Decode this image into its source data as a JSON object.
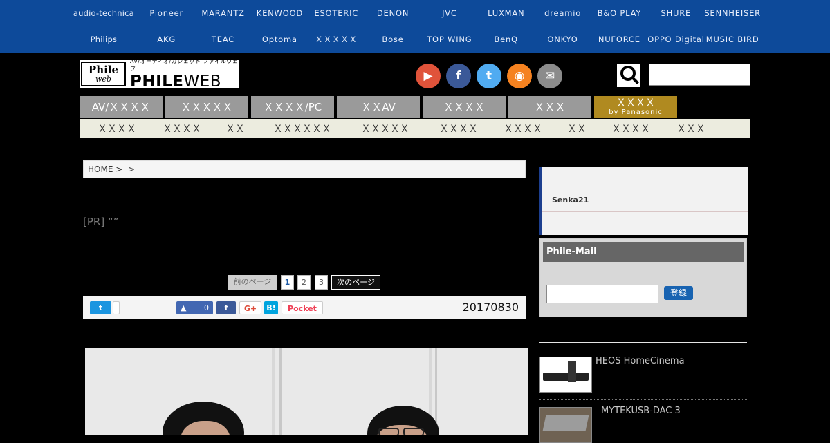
{
  "brands_row1": [
    "audio-technica",
    "Pioneer",
    "MARANTZ",
    "KENWOOD",
    "ESOTERIC",
    "DENON",
    "JVC",
    "LUXMAN",
    "dreamio",
    "B&O PLAY",
    "SHURE",
    "SENNHEISER"
  ],
  "brands_row2": [
    "Philips",
    "AKG",
    "TEAC",
    "Optoma",
    "ＸＸＸＸＸ",
    "Bose",
    "TOP WING",
    "BenQ",
    "ONKYO",
    "NUFORCE",
    "OPPO Digital",
    "MUSIC BIRD"
  ],
  "logo": {
    "mark_top": "Phile",
    "mark_bottom": "web",
    "tagline": "AV/オーディオ/ガジェット ファイルウェブ",
    "word_bold": "PHILE",
    "word_light": "WEB"
  },
  "social_icons": {
    "youtube": "▶",
    "facebook": "f",
    "twitter": "t",
    "rss": "◉",
    "mail": "✉"
  },
  "colors": {
    "brand_bar": "#0d4a9a",
    "youtube": "#e0533a",
    "facebook": "#3b5998",
    "twitter": "#50abf1",
    "rss": "#f58220",
    "mail": "#8b8b8b",
    "sidebar_accent": "#1d3f8f",
    "nav_special": "#b08a20"
  },
  "nav": [
    "AV/ＸＸＸＸ",
    "ＸＸＸＸＸ",
    "ＸＸＸＸ/PC",
    "ＸＸAV",
    "ＸＸＸＸ",
    "ＸＸＸ"
  ],
  "nav_special": {
    "label": "ＸＸＸＸ",
    "sub": "by Panasonic"
  },
  "subnav": [
    "ＸＸＸＸ",
    "ＸＸＸＸ",
    "ＸＸ",
    "ＸＸＸＸＸＸ",
    "ＸＸＸＸＸ",
    "ＸＸＸＸ",
    "ＸＸＸＸ",
    "ＸＸ",
    "ＸＸＸＸ",
    "ＸＸＸ"
  ],
  "breadcrumb": {
    "home": "HOME",
    "sep1": ">",
    "sep2": ">"
  },
  "article": {
    "title": "[PR] “”",
    "date": "20170830"
  },
  "pager": {
    "prev": "前のページ",
    "pages": [
      "1",
      "2",
      "3"
    ],
    "current": "1",
    "next": "次のページ"
  },
  "share": {
    "twitter_count": "",
    "like_count": "0",
    "pocket": "Pocket",
    "hatena": "B!",
    "gplus": "G+"
  },
  "sidebar": {
    "rows": [
      "",
      "Senka21",
      ""
    ]
  },
  "mail": {
    "title": "Phile-Mail",
    "input_placeholder": "",
    "button": "登録"
  },
  "related": [
    {
      "title": "HEOS HomeCinema"
    },
    {
      "title": "MYTEKUSB-DAC 3"
    }
  ]
}
